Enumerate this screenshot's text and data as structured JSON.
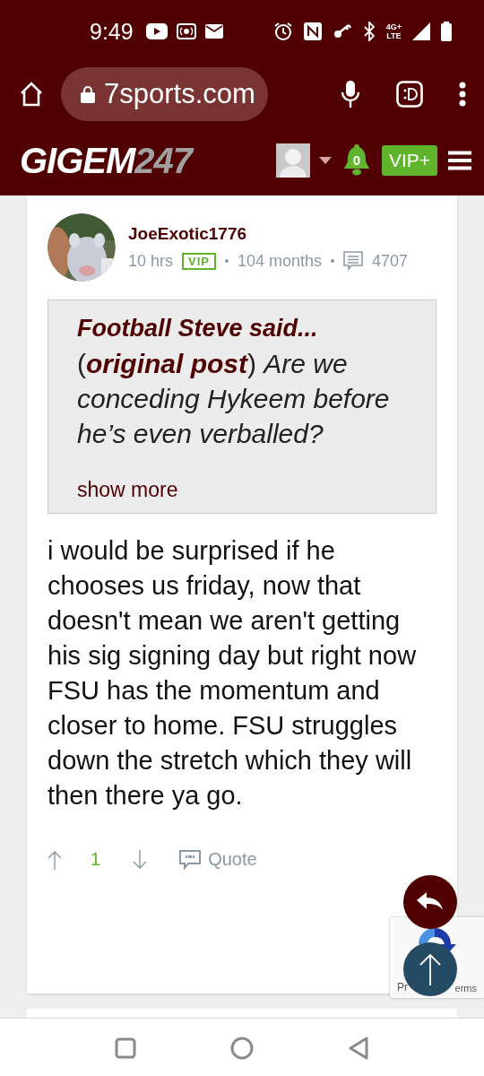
{
  "status_bar": {
    "time": "9:49",
    "network_type": "4G+",
    "network_sub": "LTE"
  },
  "browser": {
    "url": "7sports.com"
  },
  "site_header": {
    "logo_main": "GIGEM",
    "logo_accent": "247",
    "notification_count": "0",
    "vip_label": "VIP+"
  },
  "post": {
    "author": "JoeExotic1776",
    "age": "10 hrs",
    "badge": "VIP",
    "tenure": "104 months",
    "post_count": "4707",
    "quote": {
      "author": "Football Steve said...",
      "text": "(**original post**) *Are we conceding Hykeem before he’s even verballed?*",
      "show_more": "show more"
    },
    "body": "i would be surprised if he chooses us friday, now that doesn't mean we aren't getting his sig signing day but right now FSU has the momentum and closer to home. FSU struggles down the stretch which they will then there ya go.",
    "votes": "1",
    "quote_action": "Quote"
  },
  "recaptcha": {
    "text_left": "Pr",
    "text_right": "erms"
  }
}
